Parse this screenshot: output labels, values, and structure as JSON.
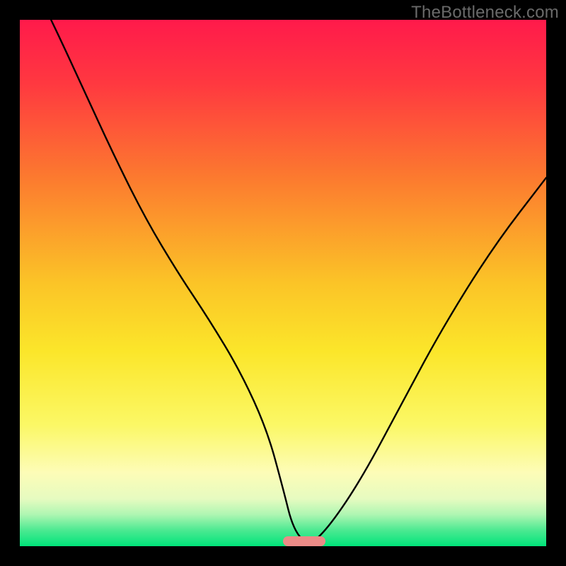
{
  "watermark": {
    "text": "TheBottleneck.com"
  },
  "chart_data": {
    "type": "line",
    "title": "",
    "xlabel": "",
    "ylabel": "",
    "xlim": [
      0,
      100
    ],
    "ylim": [
      0,
      100
    ],
    "gradient_stops": [
      {
        "pct": 0,
        "color": "#ff1a4b"
      },
      {
        "pct": 12,
        "color": "#ff3840"
      },
      {
        "pct": 30,
        "color": "#fc7a2f"
      },
      {
        "pct": 50,
        "color": "#fbc427"
      },
      {
        "pct": 63,
        "color": "#fbe62a"
      },
      {
        "pct": 77,
        "color": "#fbf866"
      },
      {
        "pct": 86,
        "color": "#fdfcb7"
      },
      {
        "pct": 91,
        "color": "#e6fbc0"
      },
      {
        "pct": 94,
        "color": "#aef6b2"
      },
      {
        "pct": 97,
        "color": "#4be991"
      },
      {
        "pct": 100,
        "color": "#00e47a"
      }
    ],
    "series": [
      {
        "name": "bottleneck-curve",
        "x": [
          0,
          6,
          12,
          18,
          24,
          30,
          36,
          42,
          47,
          50,
          52,
          55,
          59,
          65,
          72,
          80,
          90,
          100
        ],
        "values": [
          112,
          100,
          87,
          74,
          62,
          52,
          43,
          33,
          22,
          11,
          3,
          0,
          4,
          13,
          26,
          41,
          57,
          70
        ]
      }
    ],
    "marker": {
      "x_center": 54,
      "width": 8,
      "color": "#eb8b87"
    }
  }
}
